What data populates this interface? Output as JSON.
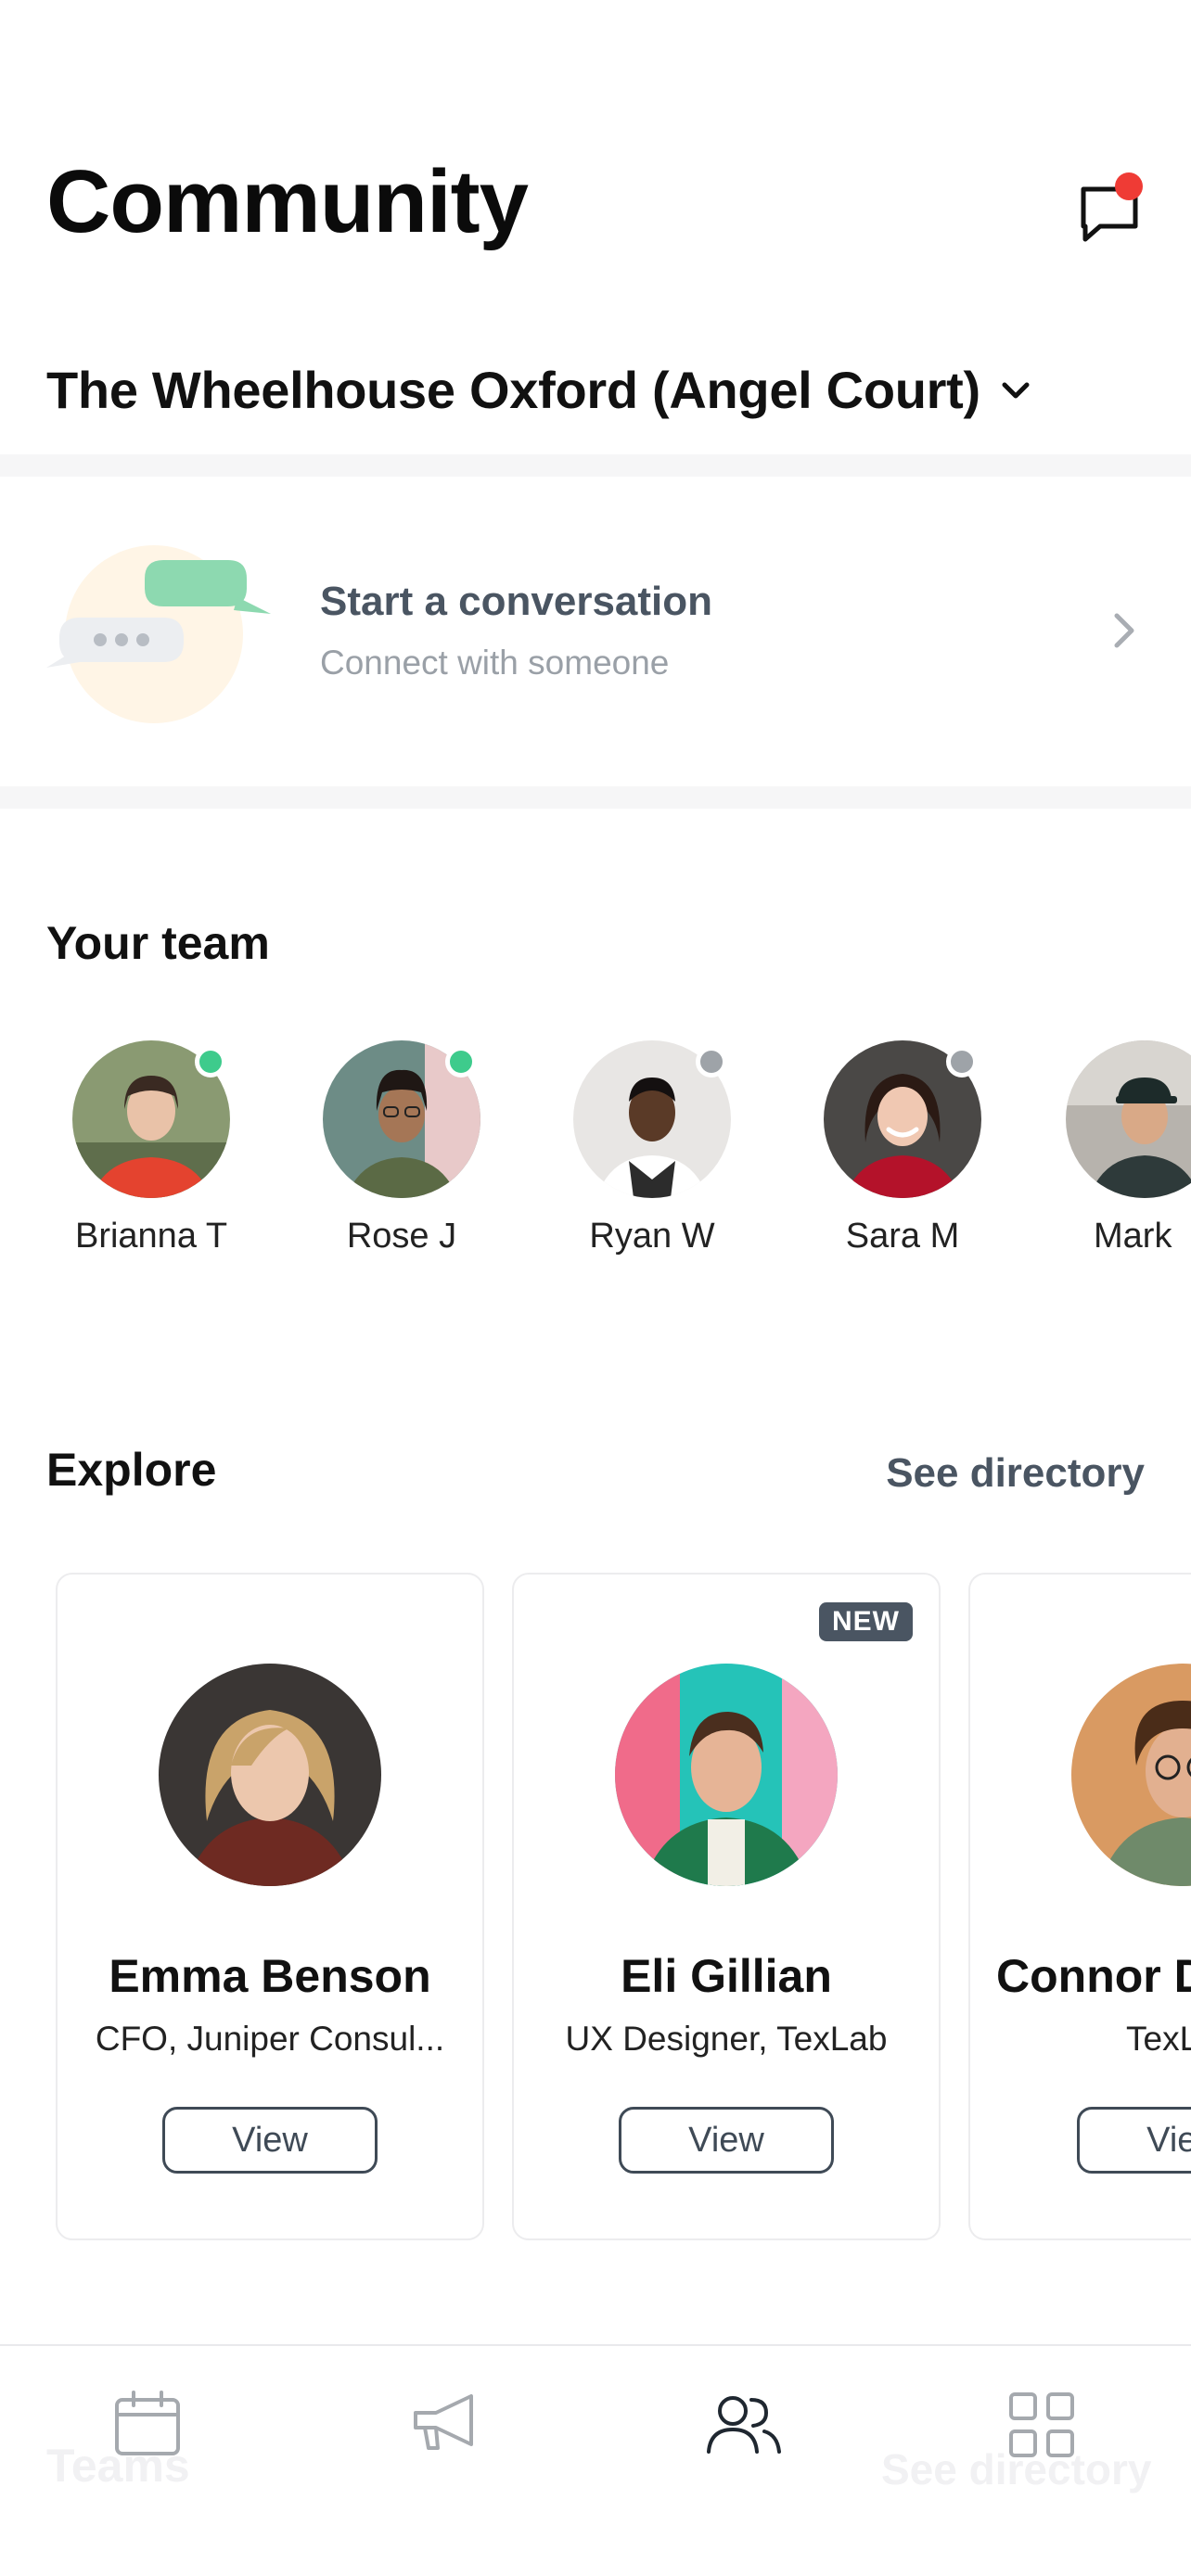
{
  "header": {
    "title": "Community"
  },
  "location": {
    "name": "The Wheelhouse Oxford (Angel Court)"
  },
  "conversation": {
    "title": "Start a conversation",
    "subtitle": "Connect with someone"
  },
  "team": {
    "title": "Your team",
    "members": [
      {
        "name": "Brianna T",
        "status": "online"
      },
      {
        "name": "Rose J",
        "status": "online"
      },
      {
        "name": "Ryan W",
        "status": "offline"
      },
      {
        "name": "Sara M",
        "status": "offline"
      },
      {
        "name": "Mark",
        "status": "unknown"
      }
    ]
  },
  "explore": {
    "title": "Explore",
    "see_directory": "See directory",
    "cards": [
      {
        "name": "Emma Benson",
        "role": "CFO, Juniper Consul...",
        "button": "View",
        "badge": ""
      },
      {
        "name": "Eli Gillian",
        "role": "UX Designer, TexLab",
        "button": "View",
        "badge": "NEW"
      },
      {
        "name": "Connor D",
        "role": "TexL",
        "button": "View",
        "badge": ""
      }
    ]
  },
  "tabbar": {
    "ghost_left": "Teams",
    "ghost_right": "See directory",
    "tabs": [
      {
        "icon": "calendar-icon"
      },
      {
        "icon": "megaphone-icon"
      },
      {
        "icon": "people-icon"
      },
      {
        "icon": "grid-icon"
      }
    ]
  },
  "colors": {
    "online": "#3ecb8c",
    "offline": "#9ea3a8",
    "notification": "#ef3b35",
    "accent_text": "#4a5562",
    "badge_bg": "#4a5562"
  }
}
